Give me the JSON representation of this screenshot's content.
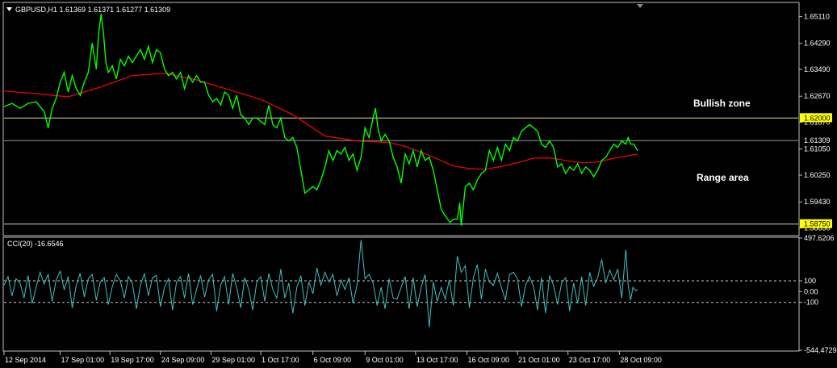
{
  "chart_data": {
    "type": "line",
    "symbol": "GBPUSD,H1",
    "ohlc": "1.61369 1.61371 1.61277 1.61309",
    "price_ylim": [
      1.5842,
      1.6552
    ],
    "price_ticks": [
      "1.65110",
      "1.64290",
      "1.63490",
      "1.62670",
      "1.61870",
      "1.61050",
      "1.60250",
      "1.59430",
      "1.58630"
    ],
    "price_tick_values": [
      1.6511,
      1.6429,
      1.6349,
      1.6267,
      1.6187,
      1.6105,
      1.6025,
      1.5943,
      1.5863
    ],
    "levels": [
      {
        "label": "1.62000",
        "value": 1.62,
        "line_color": "#d8d8a0",
        "tag_bg": "#ffff00",
        "tag_fg": "#000000"
      },
      {
        "label": "1.61309",
        "value": 1.61309,
        "line_color": "#8a9aa0",
        "tag_bg": "#000000",
        "tag_fg": "#ffffff"
      },
      {
        "label": "1.58750",
        "value": 1.5875,
        "line_color": "#d8d8d8",
        "tag_bg": "#ffff00",
        "tag_fg": "#000000"
      }
    ],
    "annotations": [
      "Bullish zone",
      "Range area"
    ],
    "price_series": {
      "color": "#00ff00",
      "x": [
        0,
        10,
        20,
        30,
        40,
        50,
        55,
        60,
        65,
        70,
        75,
        80,
        85,
        90,
        95,
        100,
        105,
        110,
        115,
        118,
        121,
        124,
        127,
        130,
        135,
        140,
        145,
        150,
        155,
        160,
        165,
        170,
        175,
        180,
        185,
        190,
        195,
        200,
        205,
        210,
        215,
        220,
        225,
        230,
        235,
        240,
        245,
        250,
        255,
        260,
        265,
        270,
        275,
        280,
        285,
        290,
        295,
        300,
        305,
        310,
        315,
        320,
        325,
        330,
        335,
        340,
        345,
        350,
        355,
        360,
        365,
        370,
        375,
        380,
        385,
        390,
        395,
        400,
        405,
        410,
        415,
        420,
        425,
        430,
        435,
        440,
        445,
        450,
        455,
        460,
        463,
        466,
        470,
        475,
        480,
        485,
        490,
        495,
        500,
        505,
        510,
        515,
        520,
        525,
        530,
        535,
        540,
        545,
        550,
        553,
        556,
        560,
        565,
        568,
        570,
        575,
        580,
        585,
        590,
        595,
        600,
        605,
        610,
        615,
        620,
        625,
        630,
        635,
        640,
        645,
        650,
        655,
        660,
        665,
        670,
        675,
        680,
        685,
        690,
        695,
        700,
        705,
        710,
        715,
        720,
        725,
        730,
        735,
        740,
        745,
        750,
        755,
        760,
        765,
        770,
        775,
        778,
        781,
        785,
        790
      ],
      "y": [
        1.6235,
        1.6245,
        1.623,
        1.6245,
        1.625,
        1.622,
        1.617,
        1.623,
        1.626,
        1.631,
        1.634,
        1.628,
        1.633,
        1.629,
        1.627,
        1.631,
        1.634,
        1.643,
        1.635,
        1.646,
        1.652,
        1.646,
        1.637,
        1.634,
        1.636,
        1.632,
        1.638,
        1.636,
        1.639,
        1.637,
        1.639,
        1.641,
        1.638,
        1.642,
        1.637,
        1.641,
        1.64,
        1.635,
        1.633,
        1.634,
        1.632,
        1.634,
        1.629,
        1.633,
        1.631,
        1.633,
        1.631,
        1.631,
        1.627,
        1.625,
        1.626,
        1.624,
        1.628,
        1.627,
        1.623,
        1.627,
        1.621,
        1.62,
        1.618,
        1.62,
        1.62,
        1.619,
        1.618,
        1.624,
        1.618,
        1.617,
        1.62,
        1.614,
        1.613,
        1.614,
        1.611,
        1.604,
        1.597,
        1.598,
        1.599,
        1.598,
        1.601,
        1.605,
        1.61,
        1.607,
        1.61,
        1.609,
        1.611,
        1.607,
        1.609,
        1.604,
        1.608,
        1.617,
        1.614,
        1.62,
        1.623,
        1.617,
        1.613,
        1.615,
        1.613,
        1.608,
        1.605,
        1.6,
        1.609,
        1.606,
        1.61,
        1.605,
        1.61,
        1.607,
        1.608,
        1.604,
        1.598,
        1.592,
        1.59,
        1.589,
        1.588,
        1.589,
        1.589,
        1.594,
        1.587,
        1.599,
        1.6,
        1.598,
        1.601,
        1.603,
        1.604,
        1.61,
        1.607,
        1.611,
        1.607,
        1.612,
        1.61,
        1.614,
        1.613,
        1.616,
        1.617,
        1.618,
        1.617,
        1.616,
        1.612,
        1.611,
        1.613,
        1.611,
        1.605,
        1.606,
        1.603,
        1.605,
        1.604,
        1.606,
        1.603,
        1.605,
        1.604,
        1.602,
        1.604,
        1.607,
        1.608,
        1.61,
        1.612,
        1.611,
        1.613,
        1.612,
        1.614,
        1.612,
        1.612,
        1.61,
        1.617,
        1.614,
        1.612,
        1.613
      ]
    },
    "ma_series": {
      "color": "#ff0000",
      "x": [
        0,
        40,
        80,
        120,
        160,
        200,
        240,
        280,
        320,
        360,
        400,
        440,
        480,
        500,
        520,
        540,
        560,
        580,
        600,
        620,
        640,
        660,
        680,
        700,
        720,
        740,
        760,
        790
      ],
      "y": [
        1.6283,
        1.6275,
        1.6265,
        1.6295,
        1.633,
        1.6337,
        1.6317,
        1.6287,
        1.6257,
        1.621,
        1.6145,
        1.613,
        1.6125,
        1.6113,
        1.6095,
        1.6075,
        1.6053,
        1.6045,
        1.6043,
        1.6052,
        1.6063,
        1.6077,
        1.6078,
        1.607,
        1.6063,
        1.6065,
        1.6077,
        1.609
      ]
    },
    "indicator": {
      "name": "CCI(20) -16.6546",
      "color": "#40c0c0",
      "ylim": [
        -544.4729,
        497.6206
      ],
      "ticks": [
        "497.6206",
        "100",
        "0.00",
        "-100",
        "-544.4729"
      ],
      "tick_values": [
        497.6206,
        100,
        0,
        -100,
        -544.4729
      ],
      "levels": [
        100,
        -100
      ],
      "x": [
        0,
        5,
        10,
        15,
        20,
        25,
        30,
        35,
        40,
        45,
        50,
        55,
        60,
        65,
        70,
        75,
        80,
        85,
        90,
        95,
        100,
        105,
        110,
        115,
        120,
        125,
        130,
        135,
        140,
        145,
        150,
        155,
        160,
        165,
        170,
        175,
        180,
        185,
        190,
        195,
        200,
        205,
        210,
        215,
        220,
        225,
        230,
        235,
        240,
        245,
        250,
        255,
        260,
        265,
        270,
        275,
        280,
        285,
        290,
        295,
        300,
        305,
        310,
        315,
        320,
        325,
        330,
        335,
        340,
        345,
        350,
        355,
        360,
        365,
        370,
        375,
        380,
        385,
        390,
        395,
        400,
        405,
        410,
        415,
        420,
        425,
        430,
        435,
        440,
        445,
        450,
        455,
        460,
        465,
        470,
        475,
        480,
        485,
        490,
        495,
        500,
        505,
        510,
        515,
        520,
        525,
        530,
        535,
        540,
        545,
        550,
        555,
        560,
        565,
        570,
        575,
        580,
        585,
        590,
        595,
        600,
        605,
        610,
        615,
        620,
        625,
        630,
        635,
        640,
        645,
        650,
        655,
        660,
        665,
        670,
        675,
        680,
        685,
        690,
        695,
        700,
        705,
        710,
        715,
        720,
        725,
        730,
        735,
        740,
        745,
        750,
        755,
        760,
        765,
        770,
        775,
        778,
        781,
        784,
        787,
        790
      ],
      "y": [
        60,
        140,
        -40,
        120,
        80,
        -60,
        150,
        -110,
        40,
        180,
        70,
        160,
        -90,
        110,
        190,
        20,
        140,
        -150,
        60,
        170,
        -50,
        120,
        160,
        -80,
        90,
        130,
        -120,
        50,
        160,
        100,
        -60,
        140,
        80,
        -160,
        60,
        170,
        -40,
        130,
        150,
        -140,
        40,
        120,
        -170,
        90,
        140,
        -60,
        170,
        -120,
        20,
        150,
        -50,
        110,
        160,
        -180,
        60,
        140,
        -120,
        170,
        40,
        -150,
        130,
        20,
        -170,
        90,
        140,
        -90,
        170,
        20,
        -60,
        210,
        -60,
        80,
        -200,
        40,
        150,
        -130,
        90,
        -20,
        220,
        60,
        180,
        90,
        160,
        -40,
        110,
        20,
        130,
        -110,
        60,
        480,
        120,
        160,
        80,
        -130,
        40,
        -160,
        120,
        -60,
        -70,
        40,
        140,
        -160,
        130,
        -140,
        40,
        160,
        -330,
        90,
        -90,
        40,
        -70,
        110,
        -130,
        330,
        180,
        240,
        -150,
        130,
        250,
        -70,
        210,
        90,
        60,
        170,
        40,
        -80,
        160,
        180,
        120,
        -140,
        60,
        140,
        50,
        -170,
        130,
        -200,
        150,
        60,
        -120,
        80,
        130,
        -180,
        80,
        -110,
        140,
        -130,
        180,
        50,
        130,
        300,
        80,
        200,
        110,
        210,
        -60,
        390,
        60,
        -80,
        40,
        10,
        20
      ]
    },
    "x_ticks": [
      "12 Sep 2014",
      "17 Sep 01:00",
      "19 Sep 17:00",
      "24 Sep 09:00",
      "29 Sep 01:00",
      "1 Oct 17:00",
      "6 Oct 09:00",
      "9 Oct 01:00",
      "13 Oct 17:00",
      "16 Oct 09:00",
      "21 Oct 01:00",
      "23 Oct 17:00",
      "28 Oct 09:00"
    ],
    "x_tick_values": [
      0,
      70,
      132,
      195,
      258,
      320,
      385,
      450,
      513,
      577,
      640,
      703,
      767
    ]
  }
}
